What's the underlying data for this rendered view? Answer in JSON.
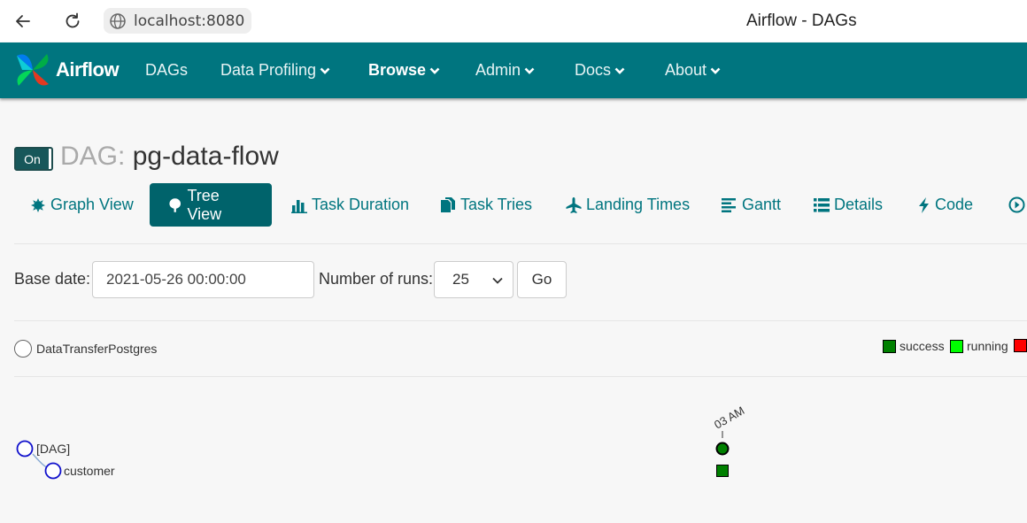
{
  "browser": {
    "url": "localhost:8080",
    "window_title": "Airflow - DAGs"
  },
  "navbar": {
    "brand": "Airflow",
    "items": [
      {
        "label": "DAGs",
        "has_dropdown": false
      },
      {
        "label": "Data Profiling",
        "has_dropdown": true
      },
      {
        "label": "Browse",
        "has_dropdown": true,
        "active": true
      },
      {
        "label": "Admin",
        "has_dropdown": true
      },
      {
        "label": "Docs",
        "has_dropdown": true
      },
      {
        "label": "About",
        "has_dropdown": true
      }
    ],
    "color": "#00757f"
  },
  "dag": {
    "toggle_label": "On",
    "prefix": "DAG:",
    "name": "pg-data-flow"
  },
  "tabs": [
    {
      "label": "Graph View",
      "icon": "asterisk-icon"
    },
    {
      "label": "Tree View",
      "icon": "tree-icon",
      "active": true
    },
    {
      "label": "Task Duration",
      "icon": "bar-chart-icon"
    },
    {
      "label": "Task Tries",
      "icon": "duplicate-icon"
    },
    {
      "label": "Landing Times",
      "icon": "plane-icon"
    },
    {
      "label": "Gantt",
      "icon": "align-left-icon"
    },
    {
      "label": "Details",
      "icon": "list-icon"
    },
    {
      "label": "Code",
      "icon": "flash-icon"
    }
  ],
  "form": {
    "base_date_label": "Base date:",
    "base_date_value": "2021-05-26 00:00:00",
    "num_runs_label": "Number of runs:",
    "num_runs_value": "25",
    "go_label": "Go"
  },
  "operator_filter": {
    "label": "DataTransferPostgres"
  },
  "legend": [
    {
      "label": "success",
      "color": "#008000"
    },
    {
      "label": "running",
      "color": "#00ff00"
    },
    {
      "label": "",
      "color": "#ff0000"
    }
  ],
  "tree": {
    "nodes": [
      {
        "label": "[DAG]"
      },
      {
        "label": "customer"
      }
    ],
    "run_label": "03 AM",
    "run_state": "success"
  }
}
